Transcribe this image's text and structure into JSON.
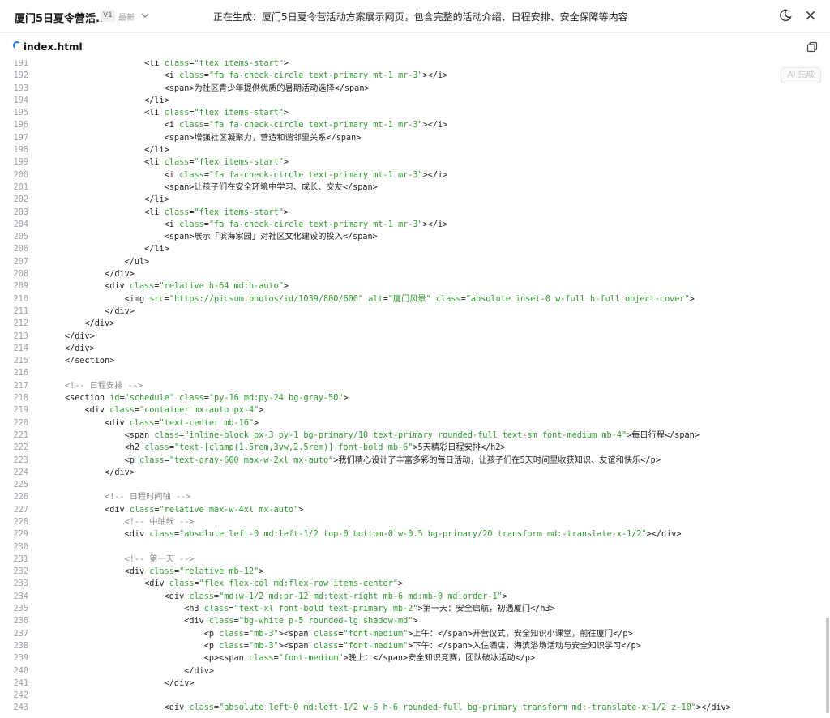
{
  "header": {
    "project_title": "厦门5日夏令营活...",
    "version": "V1",
    "latest": "最新",
    "status": "正在生成：厦门5日夏令营活动方案展示网页，包含完整的活动介绍、日程安排、安全保障等内容"
  },
  "file": {
    "name": "index.html"
  },
  "ai_button": "AI 生成",
  "code": [
    {
      "n": "191",
      "t": "                <li class=\"flex items-start\">"
    },
    {
      "n": "192",
      "t": "                    <i class=\"fa fa-check-circle text-primary mt-1 mr-3\"></i>"
    },
    {
      "n": "193",
      "t": "                    <span>为社区青少年提供优质的暑期活动选择</span>"
    },
    {
      "n": "194",
      "t": "                </li>"
    },
    {
      "n": "195",
      "t": "                <li class=\"flex items-start\">"
    },
    {
      "n": "196",
      "t": "                    <i class=\"fa fa-check-circle text-primary mt-1 mr-3\"></i>"
    },
    {
      "n": "197",
      "t": "                    <span>增强社区凝聚力，营造和谐邻里关系</span>"
    },
    {
      "n": "198",
      "t": "                </li>"
    },
    {
      "n": "199",
      "t": "                <li class=\"flex items-start\">"
    },
    {
      "n": "200",
      "t": "                    <i class=\"fa fa-check-circle text-primary mt-1 mr-3\"></i>"
    },
    {
      "n": "201",
      "t": "                    <span>让孩子们在安全环境中学习、成长、交友</span>"
    },
    {
      "n": "202",
      "t": "                </li>"
    },
    {
      "n": "203",
      "t": "                <li class=\"flex items-start\">"
    },
    {
      "n": "204",
      "t": "                    <i class=\"fa fa-check-circle text-primary mt-1 mr-3\"></i>"
    },
    {
      "n": "205",
      "t": "                    <span>展示「滨海家园」对社区文化建设的投入</span>"
    },
    {
      "n": "206",
      "t": "                </li>"
    },
    {
      "n": "207",
      "t": "            </ul>"
    },
    {
      "n": "208",
      "t": "        </div>"
    },
    {
      "n": "209",
      "t": "        <div class=\"relative h-64 md:h-auto\">"
    },
    {
      "n": "210",
      "t": "            <img src=\"https://picsum.photos/id/1039/800/600\" alt=\"厦门风景\" class=\"absolute inset-0 w-full h-full object-cover\">"
    },
    {
      "n": "211",
      "t": "        </div>"
    },
    {
      "n": "212",
      "t": "    </div>"
    },
    {
      "n": "213",
      "t": "</div>"
    },
    {
      "n": "214",
      "t": "</div>"
    },
    {
      "n": "215",
      "t": "</section>"
    },
    {
      "n": "216",
      "t": ""
    },
    {
      "n": "217",
      "t": "<!-- 日程安排 -->"
    },
    {
      "n": "218",
      "t": "<section id=\"schedule\" class=\"py-16 md:py-24 bg-gray-50\">"
    },
    {
      "n": "219",
      "t": "    <div class=\"container mx-auto px-4\">"
    },
    {
      "n": "220",
      "t": "        <div class=\"text-center mb-16\">"
    },
    {
      "n": "221",
      "t": "            <span class=\"inline-block px-3 py-1 bg-primary/10 text-primary rounded-full text-sm font-medium mb-4\">每日行程</span>"
    },
    {
      "n": "222",
      "t": "            <h2 class=\"text-[clamp(1.5rem,3vw,2.5rem)] font-bold mb-6\">5天精彩日程安排</h2>"
    },
    {
      "n": "223",
      "t": "            <p class=\"text-gray-600 max-w-2xl mx-auto\">我们精心设计了丰富多彩的每日活动，让孩子们在5天时间里收获知识、友谊和快乐</p>"
    },
    {
      "n": "224",
      "t": "        </div>"
    },
    {
      "n": "225",
      "t": ""
    },
    {
      "n": "226",
      "t": "        <!-- 日程时间轴 -->"
    },
    {
      "n": "227",
      "t": "        <div class=\"relative max-w-4xl mx-auto\">"
    },
    {
      "n": "228",
      "t": "            <!-- 中轴线 -->"
    },
    {
      "n": "229",
      "t": "            <div class=\"absolute left-0 md:left-1/2 top-0 bottom-0 w-0.5 bg-primary/20 transform md:-translate-x-1/2\"></div>"
    },
    {
      "n": "230",
      "t": ""
    },
    {
      "n": "231",
      "t": "            <!-- 第一天 -->"
    },
    {
      "n": "232",
      "t": "            <div class=\"relative mb-12\">"
    },
    {
      "n": "233",
      "t": "                <div class=\"flex flex-col md:flex-row items-center\">"
    },
    {
      "n": "234",
      "t": "                    <div class=\"md:w-1/2 md:pr-12 md:text-right mb-6 md:mb-0 md:order-1\">"
    },
    {
      "n": "235",
      "t": "                        <h3 class=\"text-xl font-bold text-primary mb-2\">第一天：安全启航，初遇厦门</h3>"
    },
    {
      "n": "236",
      "t": "                        <div class=\"bg-white p-5 rounded-lg shadow-md\">"
    },
    {
      "n": "237",
      "t": "                            <p class=\"mb-3\"><span class=\"font-medium\">上午：</span>开营仪式，安全知识小课堂，前往厦门</p>"
    },
    {
      "n": "238",
      "t": "                            <p class=\"mb-3\"><span class=\"font-medium\">下午：</span>入住酒店，海滨浴场活动与安全知识学习</p>"
    },
    {
      "n": "239",
      "t": "                            <p><span class=\"font-medium\">晚上：</span>安全知识竞赛，团队破冰活动</p>"
    },
    {
      "n": "240",
      "t": "                        </div>"
    },
    {
      "n": "241",
      "t": "                    </div>"
    },
    {
      "n": "242",
      "t": ""
    },
    {
      "n": "243",
      "t": "                    <div class=\"absolute left-0 md:left-1/2 w-6 h-6 rounded-full bg-primary transform md:-translate-x-1/2 z-10\"></div>"
    }
  ]
}
